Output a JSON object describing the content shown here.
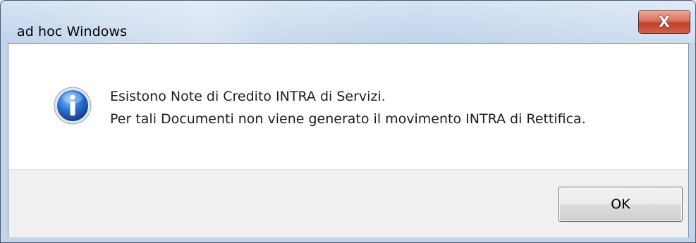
{
  "window": {
    "title": "ad hoc Windows",
    "close_label": "X"
  },
  "dialog": {
    "icon": "info-icon",
    "message_lines": [
      "Esistono Note di Credito INTRA di Servizi.",
      "Per tali Documenti non viene generato il movimento INTRA di Rettifica."
    ],
    "ok_label": "OK"
  },
  "colors": {
    "info_icon_blue": "#1f5fb8",
    "close_button_red": "#c2402a",
    "button_area_bg": "#f0f0f0"
  }
}
